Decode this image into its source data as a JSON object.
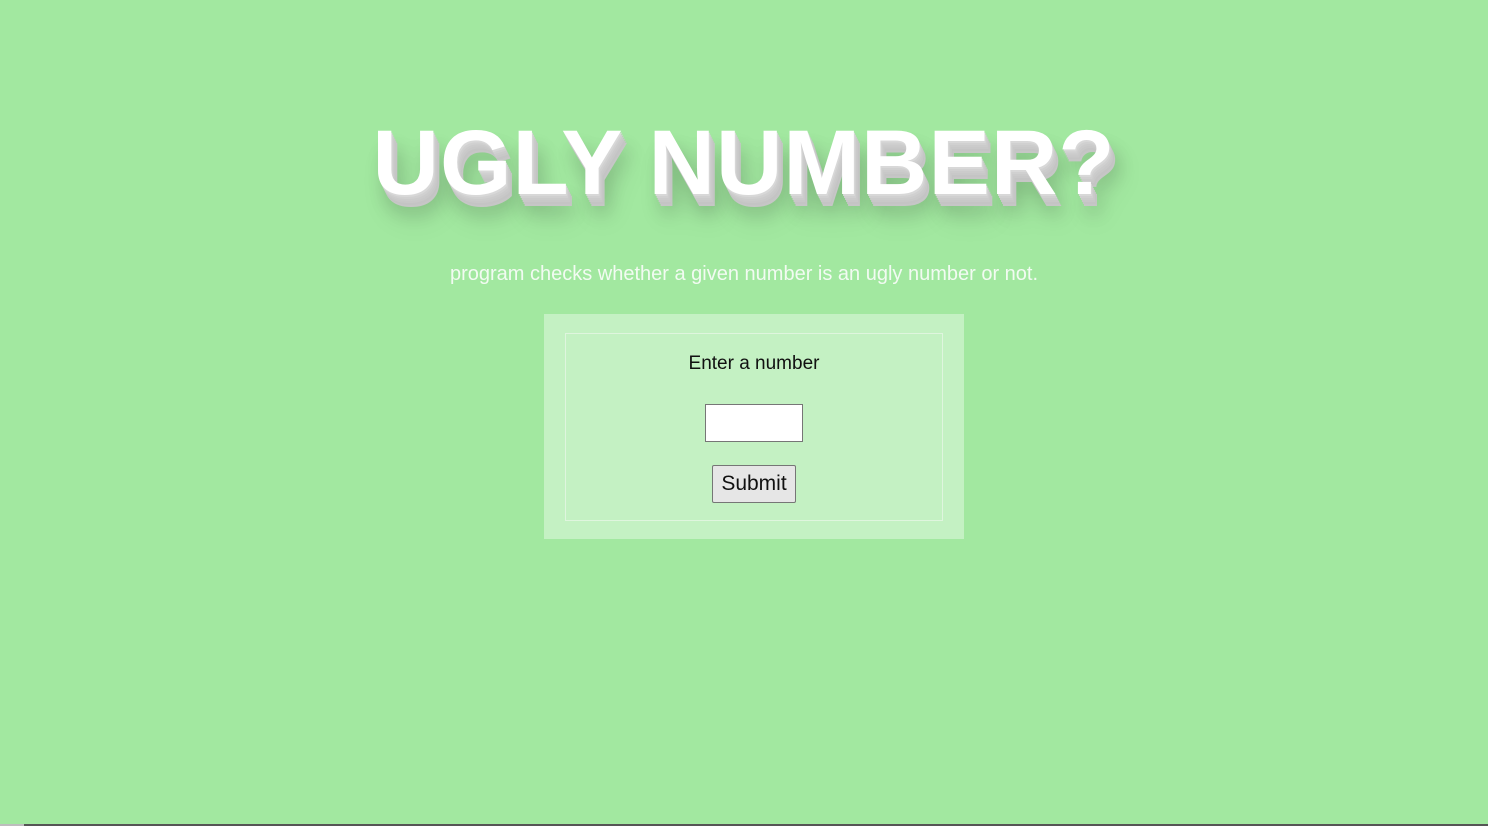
{
  "page": {
    "title": "UGLY NUMBER?",
    "subtitle": "program checks whether a given number is an ugly number or not."
  },
  "form": {
    "prompt_label": "Enter a number",
    "number_input_value": "",
    "number_input_placeholder": "",
    "submit_label": "Submit"
  },
  "colors": {
    "background": "#a2e8a0",
    "card_background": "#c4f1c3",
    "title_text": "#ffffff",
    "title_shadow": "#c8c8c8",
    "subtitle_text": "#f2fbf2"
  }
}
